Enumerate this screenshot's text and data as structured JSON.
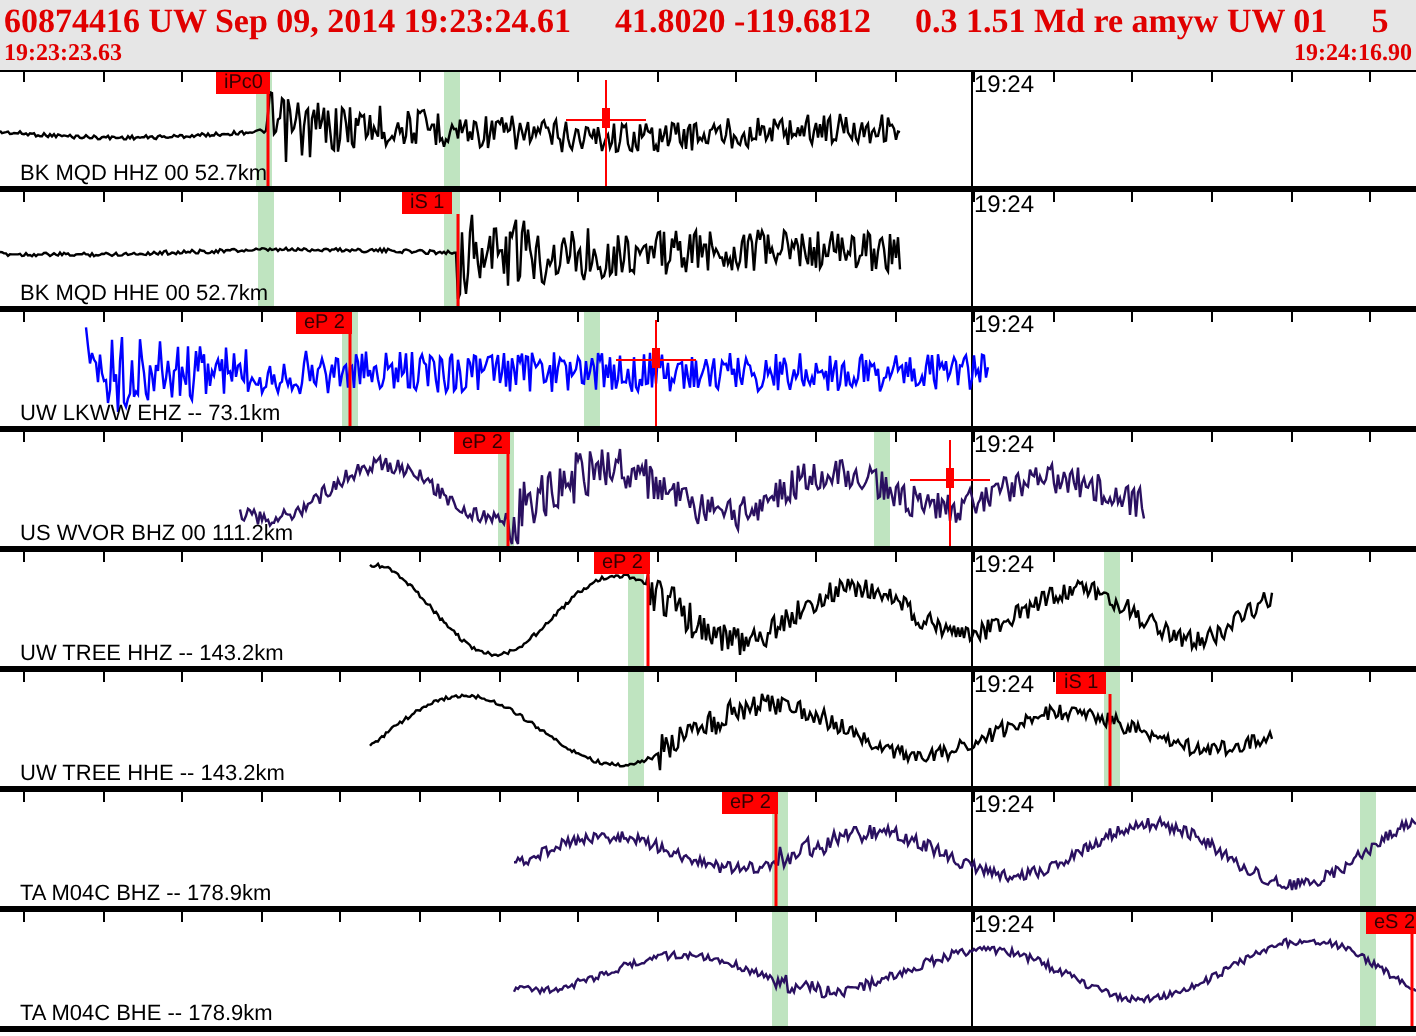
{
  "header": {
    "fields": [
      "60874416 UW Sep 09, 2014 19:23:24.61",
      "41.8020 -119.6812",
      "0.3 1.51 Md re amyw UW 01",
      "5"
    ],
    "start_time": "19:23:23.63",
    "end_time": "19:24:16.90"
  },
  "traces": [
    {
      "label": "BK MQD HHZ 00 52.7km",
      "color": "#000000",
      "time_label": "19:24",
      "picks": [
        {
          "label": "iPc0"
        }
      ]
    },
    {
      "label": "BK MQD HHE 00 52.7km",
      "color": "#000000",
      "time_label": "19:24",
      "picks": [
        {
          "label": "iS 1"
        }
      ]
    },
    {
      "label": "UW LKWW EHZ -- 73.1km",
      "color": "#0000ff",
      "time_label": "19:24",
      "picks": [
        {
          "label": "eP 2"
        }
      ]
    },
    {
      "label": "US WVOR BHZ 00 111.2km",
      "color": "#2a1060",
      "time_label": "19:24",
      "picks": [
        {
          "label": "eP 2"
        }
      ]
    },
    {
      "label": "UW TREE HHZ -- 143.2km",
      "color": "#000000",
      "time_label": "19:24",
      "picks": [
        {
          "label": "eP 2"
        }
      ]
    },
    {
      "label": "UW TREE HHE -- 143.2km",
      "color": "#000000",
      "time_label": "19:24",
      "picks": [
        {
          "label": "iS 1"
        }
      ]
    },
    {
      "label": "TA M04C BHZ -- 178.9km",
      "color": "#2a1060",
      "time_label": "19:24",
      "picks": [
        {
          "label": "eP 2"
        }
      ]
    },
    {
      "label": "TA M04C BHE -- 178.9km",
      "color": "#2a1060",
      "time_label": "19:24",
      "picks": [
        {
          "label": "eS 2"
        }
      ]
    }
  ]
}
